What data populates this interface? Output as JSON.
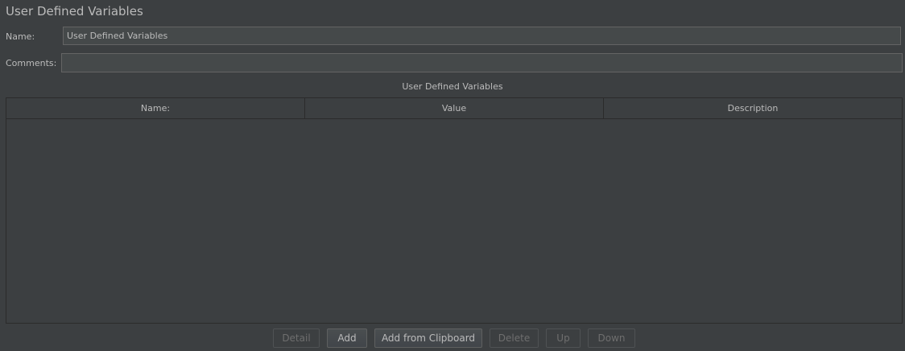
{
  "page": {
    "title": "User Defined Variables"
  },
  "form": {
    "name_label": "Name:",
    "name_value": "User Defined Variables",
    "comments_label": "Comments:",
    "comments_value": ""
  },
  "table": {
    "caption": "User Defined Variables",
    "columns": [
      "Name:",
      "Value",
      "Description"
    ],
    "rows": []
  },
  "buttons": {
    "detail": {
      "label": "Detail",
      "enabled": false
    },
    "add": {
      "label": "Add",
      "enabled": true
    },
    "add_from_clipboard": {
      "label": "Add from Clipboard",
      "enabled": true
    },
    "delete": {
      "label": "Delete",
      "enabled": false
    },
    "up": {
      "label": "Up",
      "enabled": false
    },
    "down": {
      "label": "Down",
      "enabled": false
    }
  },
  "colors": {
    "background": "#3c3f41",
    "field_background": "#45494a",
    "text": "#bbbbbb",
    "disabled_text": "#6e6e6e",
    "border": "#2b2b2b"
  }
}
